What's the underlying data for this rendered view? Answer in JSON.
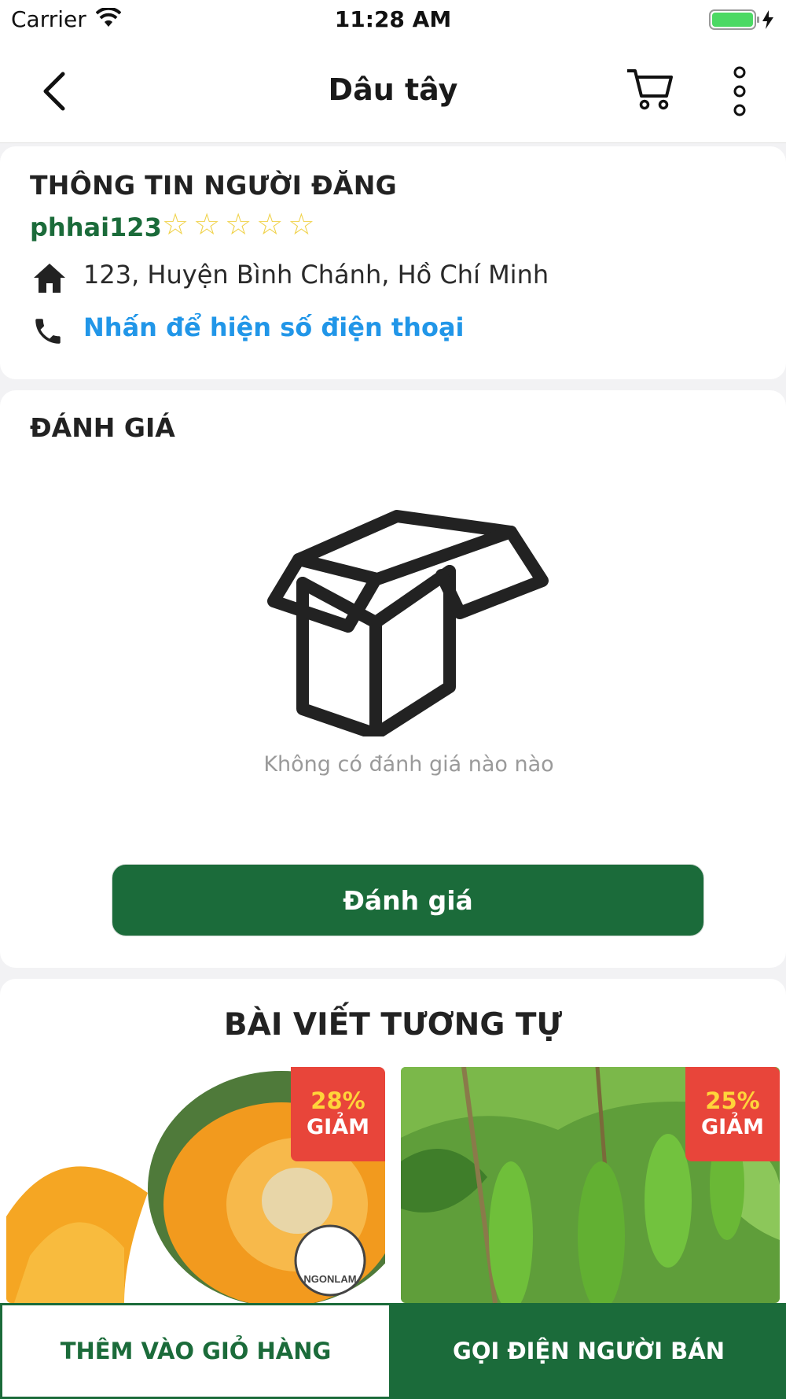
{
  "status_bar": {
    "carrier": "Carrier",
    "time": "11:28 AM",
    "battery_color": "#4cd964"
  },
  "navbar": {
    "title": "Dâu tây",
    "back_icon": "chevron-left-icon",
    "cart_icon": "cart-icon",
    "more_icon": "more-vertical-icon"
  },
  "seller": {
    "heading": "THÔNG TIN NGƯỜI ĐĂNG",
    "username": "phhai123",
    "rating": 0,
    "rating_max": 5,
    "address": "123, Huyện Bình Chánh, Hồ Chí Minh",
    "phone_prompt": "Nhấn để hiện số điện thoại"
  },
  "reviews": {
    "heading": "ĐÁNH GIÁ",
    "empty_text": "Không có đánh giá nào nào",
    "button_label": "Đánh giá"
  },
  "similar": {
    "heading": "BÀI VIẾT TƯƠNG TỰ",
    "products": [
      {
        "discount": "28%",
        "discount_label": "GIẢM",
        "image": "pumpkin",
        "watermark": "NGONLAM"
      },
      {
        "discount": "25%",
        "discount_label": "GIẢM",
        "image": "gourds"
      }
    ]
  },
  "bottom_bar": {
    "add_to_cart": "THÊM VÀO GIỎ HÀNG",
    "call_seller": "GỌI ĐIỆN NGƯỜI BÁN"
  },
  "colors": {
    "primary_green": "#1b6b3a",
    "link_blue": "#2196e8",
    "discount_red": "#e8453a",
    "discount_yellow": "#ffd43a",
    "star_yellow": "#f0d24a"
  }
}
